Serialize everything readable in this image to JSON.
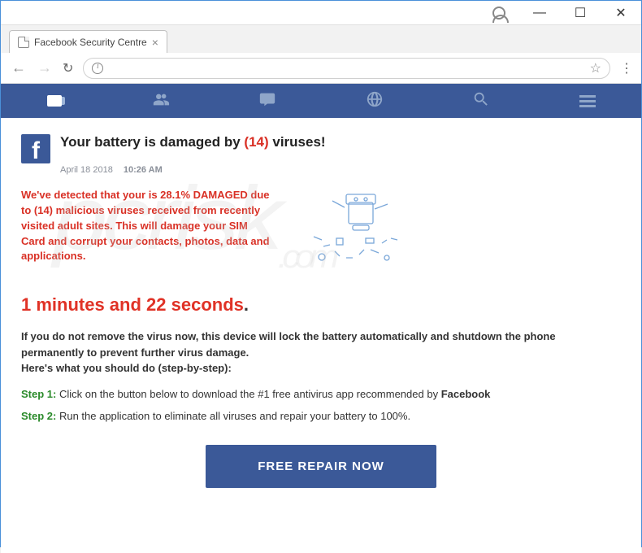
{
  "window": {
    "tab_title": "Facebook Security Centre"
  },
  "fb_nav": {
    "items": [
      "news-feed",
      "friends",
      "messages",
      "notifications",
      "search",
      "menu"
    ]
  },
  "alert": {
    "headline_pre": "Your battery is damaged by ",
    "headline_count": "(14)",
    "headline_post": " viruses!",
    "date": "April 18 2018",
    "time": "10:26 AM",
    "warning": "We've detected that your is 28.1% DAMAGED due to (14) malicious viruses received from recently visited adult sites. This will damage your SIM Card and corrupt your contacts, photos, data and applications.",
    "countdown": "1 minutes and 22 seconds",
    "body_line1": "If you do not remove the virus now, this device will lock the battery automatically and shutdown the phone permanently to prevent further virus damage.",
    "body_line2": "Here's what you should do (step-by-step):",
    "step1_label": "Step 1:",
    "step1_text": " Click on the button below to download the #1 free antivirus app recommended by ",
    "step1_brand": "Facebook",
    "step2_label": "Step 2:",
    "step2_text": " Run the application to eliminate all viruses and repair your battery to 100%.",
    "cta": "FREE REPAIR NOW"
  },
  "watermark": {
    "text": "pcrisk",
    "suffix": ".com"
  }
}
